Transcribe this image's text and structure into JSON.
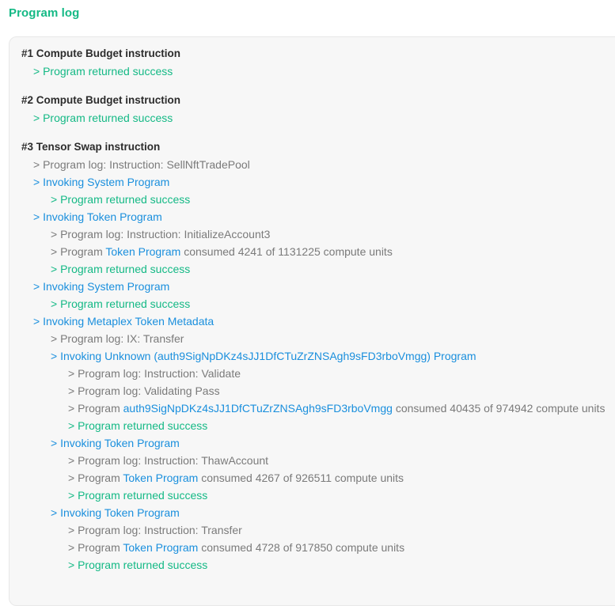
{
  "title": "Program log",
  "colors": {
    "success": "#14b985",
    "invoke": "#1a8fdd",
    "log": "#7a7a7a",
    "header": "#2c2c2c"
  },
  "log": {
    "ix1_header": "#1 Compute Budget instruction",
    "ix1_success": "> Program returned success",
    "ix2_header": "#2 Compute Budget instruction",
    "ix2_success": "> Program returned success",
    "ix3_header": "#3 Tensor Swap instruction",
    "l1": "> Program log: Instruction: SellNftTradePool",
    "l2": "> Invoking System Program",
    "l3": "> Program returned success",
    "l4": "> Invoking Token Program",
    "l5": "> Program log: Instruction: InitializeAccount3",
    "l6_prefix": "> Program",
    "l6_program": "Token Program",
    "l6_suffix": "consumed 4241 of 1131225 compute units",
    "l7": "> Program returned success",
    "l8": "> Invoking System Program",
    "l9": "> Program returned success",
    "l10": "> Invoking Metaplex Token Metadata",
    "l11": "> Program log: IX: Transfer",
    "l12": "> Invoking Unknown (auth9SigNpDKz4sJJ1DfCTuZrZNSAgh9sFD3rboVmgg) Program",
    "l13": "> Program log: Instruction: Validate",
    "l14": "> Program log: Validating Pass",
    "l15_prefix": "> Program",
    "l15_program": "auth9SigNpDKz4sJJ1DfCTuZrZNSAgh9sFD3rboVmgg",
    "l15_suffix": "consumed 40435 of 974942 compute units",
    "l16": "> Program returned success",
    "l17": "> Invoking Token Program",
    "l18": "> Program log: Instruction: ThawAccount",
    "l19_prefix": "> Program",
    "l19_program": "Token Program",
    "l19_suffix": "consumed 4267 of 926511 compute units",
    "l20": "> Program returned success",
    "l21": "> Invoking Token Program",
    "l22": "> Program log: Instruction: Transfer",
    "l23_prefix": "> Program",
    "l23_program": "Token Program",
    "l23_suffix": "consumed 4728 of 917850 compute units",
    "l24": "> Program returned success"
  }
}
